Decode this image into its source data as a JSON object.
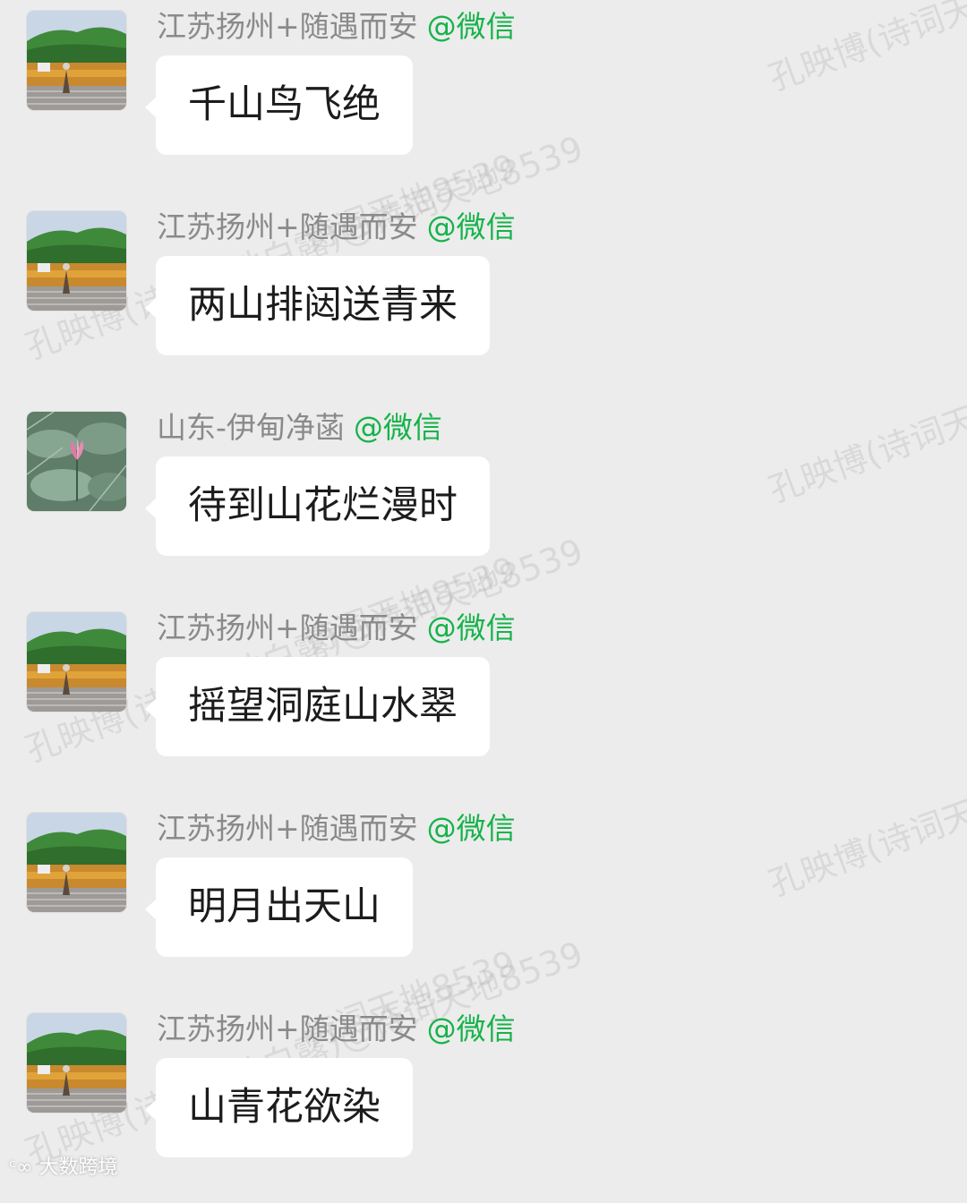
{
  "messages": [
    {
      "sender": "江苏扬州+随遇而安",
      "tag": "@微信",
      "text": "千山鸟飞绝",
      "avatar": "landscape-avatar"
    },
    {
      "sender": "江苏扬州+随遇而安",
      "tag": "@微信",
      "text": "两山排闼送青来",
      "avatar": "landscape-avatar"
    },
    {
      "sender": "山东-伊甸净菡",
      "tag": "@微信",
      "text": "待到山花烂漫时",
      "avatar": "lotus-avatar"
    },
    {
      "sender": "江苏扬州+随遇而安",
      "tag": "@微信",
      "text": "摇望洞庭山水翠",
      "avatar": "landscape-avatar"
    },
    {
      "sender": "江苏扬州+随遇而安",
      "tag": "@微信",
      "text": "明月出天山",
      "avatar": "landscape-avatar"
    },
    {
      "sender": "江苏扬州+随遇而安",
      "tag": "@微信",
      "text": "山青花欲染",
      "avatar": "landscape-avatar"
    }
  ],
  "watermarks": [
    "孔映博(诗词天地",
    "诗词天地8539",
    "孔映博(诗词天地白露)@诗词天地8539",
    "孔映博(诗词天地"
  ],
  "corner_logo": "大数跨境",
  "colors": {
    "background": "#ececec",
    "bubble": "#ffffff",
    "sender_name": "#8a8a8a",
    "sender_tag": "#16b34a",
    "message_text": "#1c1c1c"
  }
}
